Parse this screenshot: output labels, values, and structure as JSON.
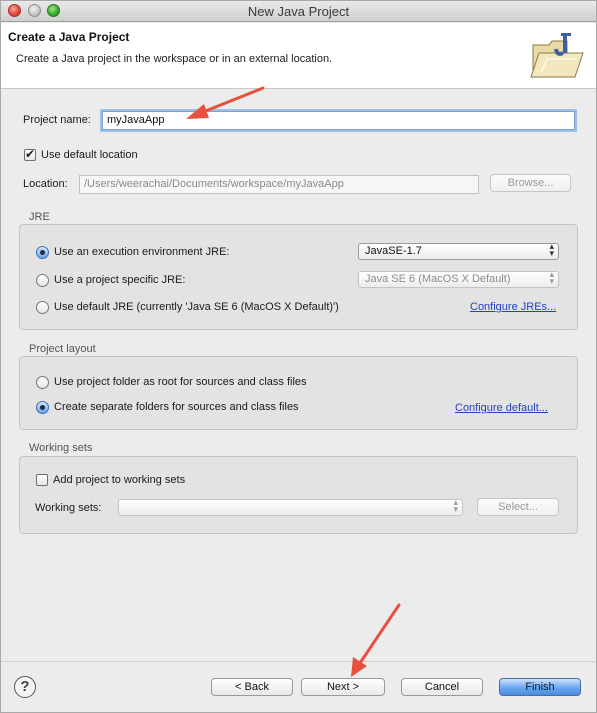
{
  "window": {
    "title": "New Java Project"
  },
  "banner": {
    "title": "Create a Java Project",
    "description": "Create a Java project in the workspace or in an external location."
  },
  "project": {
    "name_label": "Project name:",
    "name_value": "myJavaApp",
    "use_default_location_label": "Use default location",
    "use_default_location_checked": true,
    "location_label": "Location:",
    "location_value": "/Users/weerachai/Documents/workspace/myJavaApp",
    "browse_label": "Browse..."
  },
  "jre": {
    "group_label": "JRE",
    "options": [
      {
        "label": "Use an execution environment JRE:",
        "selected": true
      },
      {
        "label": "Use a project specific JRE:",
        "selected": false
      },
      {
        "label": "Use default JRE (currently 'Java SE 6 (MacOS X Default)')",
        "selected": false
      }
    ],
    "execution_env_value": "JavaSE-1.7",
    "project_jre_value": "Java SE 6 (MacOS X Default)",
    "configure_jres_link": "Configure JREs..."
  },
  "layout": {
    "group_label": "Project layout",
    "options": [
      {
        "label": "Use project folder as root for sources and class files",
        "selected": false
      },
      {
        "label": "Create separate folders for sources and class files",
        "selected": true
      }
    ],
    "configure_default_link": "Configure default..."
  },
  "working_sets": {
    "group_label": "Working sets",
    "add_label": "Add project to working sets",
    "add_checked": false,
    "sets_label": "Working sets:",
    "sets_value": "",
    "select_label": "Select..."
  },
  "footer": {
    "help_symbol": "?",
    "back_label": "< Back",
    "next_label": "Next >",
    "cancel_label": "Cancel",
    "finish_label": "Finish"
  },
  "icons": [
    "folder-j-icon",
    "help-icon",
    "chevron-updown-icon",
    "checkmark-icon"
  ],
  "colors": {
    "link": "#2543b8",
    "default_button": "#5a97e8",
    "annotation_arrow": "#e8503e"
  }
}
